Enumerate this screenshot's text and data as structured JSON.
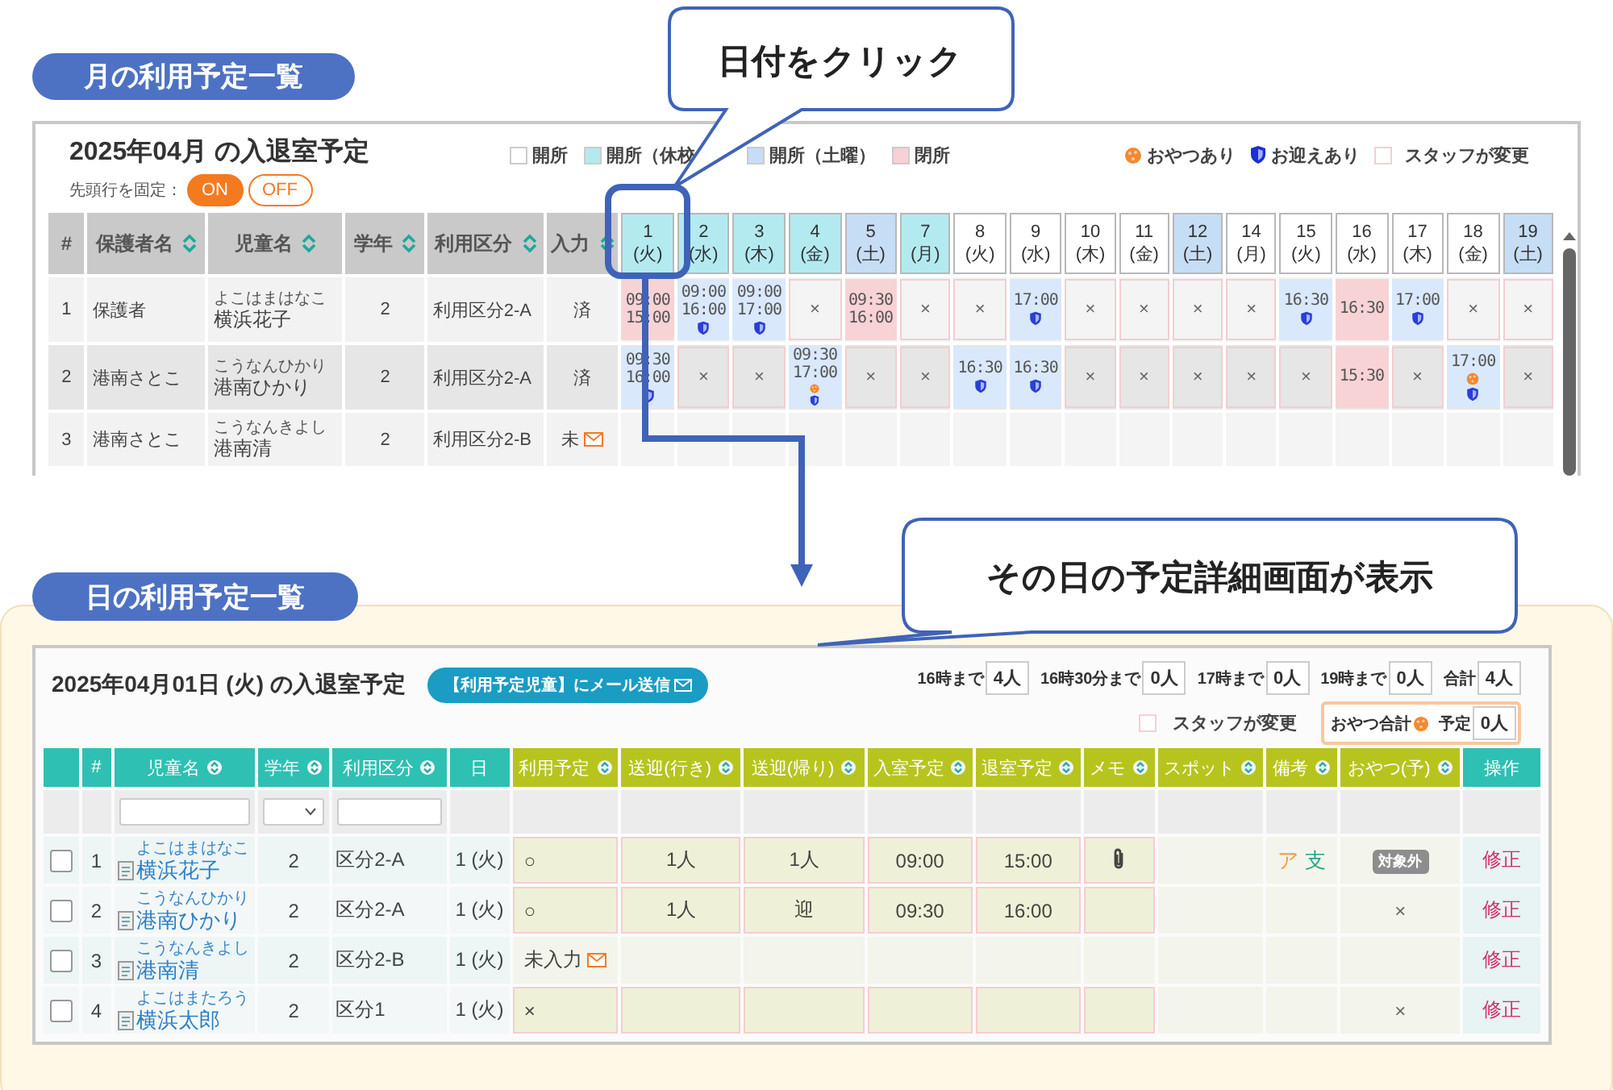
{
  "callouts": [
    "日付をクリック",
    "その日の予定詳細画面が表示"
  ],
  "month_view": {
    "heading": "月の利用予定一覧",
    "title": "2025年04月 の入退室予定",
    "freeze": {
      "label": "先頭行を固定：",
      "options": [
        {
          "label": "ON",
          "selected": true
        },
        {
          "label": "OFF",
          "selected": false
        }
      ]
    },
    "legend": [
      {
        "label": "開所",
        "color": "#ffffff"
      },
      {
        "label": "開所（休校",
        "color": "#b3eaf0"
      },
      {
        "label": "開所（土曜）",
        "color": "#c6ddf6"
      },
      {
        "label": "閉所",
        "color": "#f8d0d6"
      }
    ],
    "markers": [
      {
        "kind": "snack",
        "label": "おやつあり"
      },
      {
        "kind": "pickup",
        "label": "お迎えあり"
      },
      {
        "kind": "staff",
        "label": "スタッフが変更"
      }
    ],
    "columns": [
      {
        "label": "#",
        "sortable": false
      },
      {
        "label": "保護者名",
        "sortable": true
      },
      {
        "label": "児童名",
        "sortable": true
      },
      {
        "label": "学年",
        "sortable": true
      },
      {
        "label": "利用区分",
        "sortable": true
      },
      {
        "label": "入力",
        "sortable": true
      }
    ],
    "days": [
      {
        "date": "1",
        "weekday": "(火)",
        "color": "#b3eaf0"
      },
      {
        "date": "2",
        "weekday": "(水)",
        "color": "#b3eaf0"
      },
      {
        "date": "3",
        "weekday": "(木)",
        "color": "#b3eaf0"
      },
      {
        "date": "4",
        "weekday": "(金)",
        "color": "#b3eaf0"
      },
      {
        "date": "5",
        "weekday": "(土)",
        "color": "#c6ddf6"
      },
      {
        "date": "7",
        "weekday": "(月)",
        "color": "#b3eaf0"
      },
      {
        "date": "8",
        "weekday": "(火)",
        "color": "#ffffff"
      },
      {
        "date": "9",
        "weekday": "(水)",
        "color": "#ffffff"
      },
      {
        "date": "10",
        "weekday": "(木)",
        "color": "#ffffff"
      },
      {
        "date": "11",
        "weekday": "(金)",
        "color": "#ffffff"
      },
      {
        "date": "12",
        "weekday": "(土)",
        "color": "#c6ddf6"
      },
      {
        "date": "14",
        "weekday": "(月)",
        "color": "#ffffff"
      },
      {
        "date": "15",
        "weekday": "(火)",
        "color": "#ffffff"
      },
      {
        "date": "16",
        "weekday": "(水)",
        "color": "#ffffff"
      },
      {
        "date": "17",
        "weekday": "(木)",
        "color": "#ffffff"
      },
      {
        "date": "18",
        "weekday": "(金)",
        "color": "#ffffff"
      },
      {
        "date": "19",
        "weekday": "(土)",
        "color": "#c6ddf6"
      }
    ],
    "rows": [
      {
        "no": "1",
        "guardian": "保護者",
        "child": "横浜花子",
        "reading": "よこはまはなこ",
        "grade": "2",
        "category": "利用区分2-A",
        "input": "済",
        "input_mail": false,
        "cells": [
          {
            "kind": "closed",
            "times": [
              "09:00",
              "15:00"
            ],
            "snack": false,
            "pickup": false
          },
          {
            "kind": "planned",
            "times": [
              "09:00",
              "16:00"
            ],
            "snack": false,
            "pickup": true
          },
          {
            "kind": "planned",
            "times": [
              "09:00",
              "17:00"
            ],
            "snack": false,
            "pickup": true
          },
          {
            "kind": "none",
            "mark": "×"
          },
          {
            "kind": "closed",
            "times": [
              "09:30",
              "16:00"
            ],
            "snack": false,
            "pickup": false
          },
          {
            "kind": "none",
            "mark": "×"
          },
          {
            "kind": "none",
            "mark": "×"
          },
          {
            "kind": "planned",
            "times": [
              "17:00"
            ],
            "snack": false,
            "pickup": true
          },
          {
            "kind": "none",
            "mark": "×"
          },
          {
            "kind": "none",
            "mark": "×"
          },
          {
            "kind": "none",
            "mark": "×"
          },
          {
            "kind": "none",
            "mark": "×"
          },
          {
            "kind": "planned",
            "times": [
              "16:30"
            ],
            "snack": false,
            "pickup": true
          },
          {
            "kind": "closed",
            "times": [
              "16:30"
            ],
            "snack": false,
            "pickup": false
          },
          {
            "kind": "planned",
            "times": [
              "17:00"
            ],
            "snack": false,
            "pickup": true
          },
          {
            "kind": "none",
            "mark": "×"
          },
          {
            "kind": "none",
            "mark": "×"
          }
        ]
      },
      {
        "no": "2",
        "guardian": "港南さとこ",
        "child": "港南ひかり",
        "reading": "こうなんひかり",
        "grade": "2",
        "category": "利用区分2-A",
        "input": "済",
        "input_mail": false,
        "cells": [
          {
            "kind": "planned",
            "times": [
              "09:30",
              "16:00"
            ],
            "snack": false,
            "pickup": true
          },
          {
            "kind": "none",
            "mark": "×"
          },
          {
            "kind": "none",
            "mark": "×"
          },
          {
            "kind": "planned",
            "times": [
              "09:30",
              "17:00"
            ],
            "snack": true,
            "pickup": true
          },
          {
            "kind": "none",
            "mark": "×"
          },
          {
            "kind": "none",
            "mark": "×"
          },
          {
            "kind": "planned",
            "times": [
              "16:30"
            ],
            "snack": false,
            "pickup": true
          },
          {
            "kind": "planned",
            "times": [
              "16:30"
            ],
            "snack": false,
            "pickup": true
          },
          {
            "kind": "none",
            "mark": "×"
          },
          {
            "kind": "none",
            "mark": "×"
          },
          {
            "kind": "none",
            "mark": "×"
          },
          {
            "kind": "none",
            "mark": "×"
          },
          {
            "kind": "none",
            "mark": "×"
          },
          {
            "kind": "closed",
            "times": [
              "15:30"
            ],
            "snack": false,
            "pickup": false
          },
          {
            "kind": "none",
            "mark": "×"
          },
          {
            "kind": "planned",
            "times": [
              "17:00"
            ],
            "snack": true,
            "pickup": true
          },
          {
            "kind": "none",
            "mark": "×"
          }
        ]
      },
      {
        "no": "3",
        "guardian": "港南さとこ",
        "child": "港南清",
        "reading": "こうなんきよし",
        "grade": "2",
        "category": "利用区分2-B",
        "input": "未",
        "input_mail": true,
        "cells": [
          {
            "kind": "empty"
          },
          {
            "kind": "empty"
          },
          {
            "kind": "empty"
          },
          {
            "kind": "empty"
          },
          {
            "kind": "empty"
          },
          {
            "kind": "empty"
          },
          {
            "kind": "empty"
          },
          {
            "kind": "empty"
          },
          {
            "kind": "empty"
          },
          {
            "kind": "empty"
          },
          {
            "kind": "empty"
          },
          {
            "kind": "empty"
          },
          {
            "kind": "empty"
          },
          {
            "kind": "empty"
          },
          {
            "kind": "empty"
          },
          {
            "kind": "empty"
          },
          {
            "kind": "empty"
          }
        ]
      }
    ]
  },
  "day_view": {
    "heading": "日の利用予定一覧",
    "title": "2025年04月01日 (火) の入退室予定",
    "mail_button": "【利用予定児童】にメール送信",
    "counts": [
      {
        "label": "16時まで",
        "value": "4人"
      },
      {
        "label": "16時30分まで",
        "value": "0人"
      },
      {
        "label": "17時まで",
        "value": "0人"
      },
      {
        "label": "19時まで",
        "value": "0人"
      },
      {
        "label": "合計",
        "value": "4人"
      }
    ],
    "staff_legend": "スタッフが変更",
    "snack_total": {
      "label": "おやつ合計",
      "sub": "予定",
      "value": "0人"
    },
    "columns": [
      {
        "label": "#",
        "kind": "basic",
        "sortable": false
      },
      {
        "label": "児童名",
        "kind": "basic",
        "sortable": true
      },
      {
        "label": "学年",
        "kind": "basic",
        "sortable": true
      },
      {
        "label": "利用区分",
        "kind": "basic",
        "sortable": true
      },
      {
        "label": "日",
        "kind": "basic",
        "sortable": false
      },
      {
        "label": "利用予定",
        "kind": "plan",
        "sortable": true
      },
      {
        "label": "送迎(行き)",
        "kind": "plan",
        "sortable": true
      },
      {
        "label": "送迎(帰り)",
        "kind": "plan",
        "sortable": true
      },
      {
        "label": "入室予定",
        "kind": "plan",
        "sortable": true
      },
      {
        "label": "退室予定",
        "kind": "plan",
        "sortable": true
      },
      {
        "label": "メモ",
        "kind": "plan",
        "sortable": true
      },
      {
        "label": "スポット",
        "kind": "plan",
        "sortable": true
      },
      {
        "label": "備考",
        "kind": "plan",
        "sortable": true
      },
      {
        "label": "おやつ(予)",
        "kind": "plan",
        "sortable": true
      },
      {
        "label": "操作",
        "kind": "basic",
        "sortable": false
      }
    ],
    "rows": [
      {
        "checked": false,
        "no": "1",
        "child": "横浜花子",
        "reading": "よこはまはなこ",
        "grade": "2",
        "category": "区分2-A",
        "day": "1 (火)",
        "staff_changed": true,
        "plan": "○",
        "plan_mail": false,
        "to": "1人",
        "back": "1人",
        "in": "09:00",
        "out": "15:00",
        "memo": true,
        "notes": [
          {
            "text": "ア",
            "color": "#f39a3c"
          },
          {
            "text": "支",
            "color": "#2aa58a"
          }
        ],
        "snack": {
          "kind": "badge",
          "text": "対象外"
        },
        "action": "修正"
      },
      {
        "checked": false,
        "no": "2",
        "child": "港南ひかり",
        "reading": "こうなんひかり",
        "grade": "2",
        "category": "区分2-A",
        "day": "1 (火)",
        "staff_changed": true,
        "plan": "○",
        "plan_mail": false,
        "to": "1人",
        "back": "迎",
        "in": "09:30",
        "out": "16:00",
        "memo": false,
        "snack": {
          "kind": "mark",
          "text": "×"
        },
        "action": "修正"
      },
      {
        "checked": false,
        "no": "3",
        "child": "港南清",
        "reading": "こうなんきよし",
        "grade": "2",
        "category": "区分2-B",
        "day": "1 (火)",
        "staff_changed": false,
        "plan": "未入力",
        "plan_mail": true,
        "memo": false,
        "action": "修正"
      },
      {
        "checked": false,
        "no": "4",
        "child": "横浜太郎",
        "reading": "よこはまたろう",
        "grade": "2",
        "category": "区分1",
        "day": "1 (火)",
        "staff_changed": true,
        "plan": "×",
        "plan_mail": false,
        "memo": false,
        "snack": {
          "kind": "mark",
          "text": "×"
        },
        "action": "修正"
      }
    ]
  }
}
